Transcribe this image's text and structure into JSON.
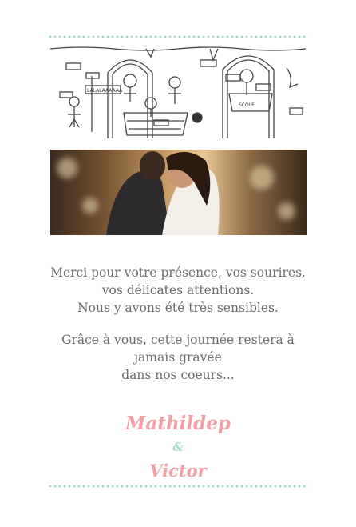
{
  "illustration": {
    "banner_text": "LALALAAAAAA",
    "sign_text": "SCOLE"
  },
  "message": {
    "paragraph1": [
      "Merci pour votre présence, vos sourires,",
      "vos délicates attentions.",
      "Nous y avons été très sensibles."
    ],
    "paragraph2": [
      "Grâce à vous, cette journée restera à",
      "jamais gravée",
      "dans nos coeurs..."
    ]
  },
  "signature": {
    "name1": "Mathildep",
    "ampersand": "&",
    "name2": "Victor"
  },
  "colors": {
    "accent_pink": "#f2a0a6",
    "accent_mint": "#9fd8d0",
    "text_gray": "#6b6b6b"
  }
}
